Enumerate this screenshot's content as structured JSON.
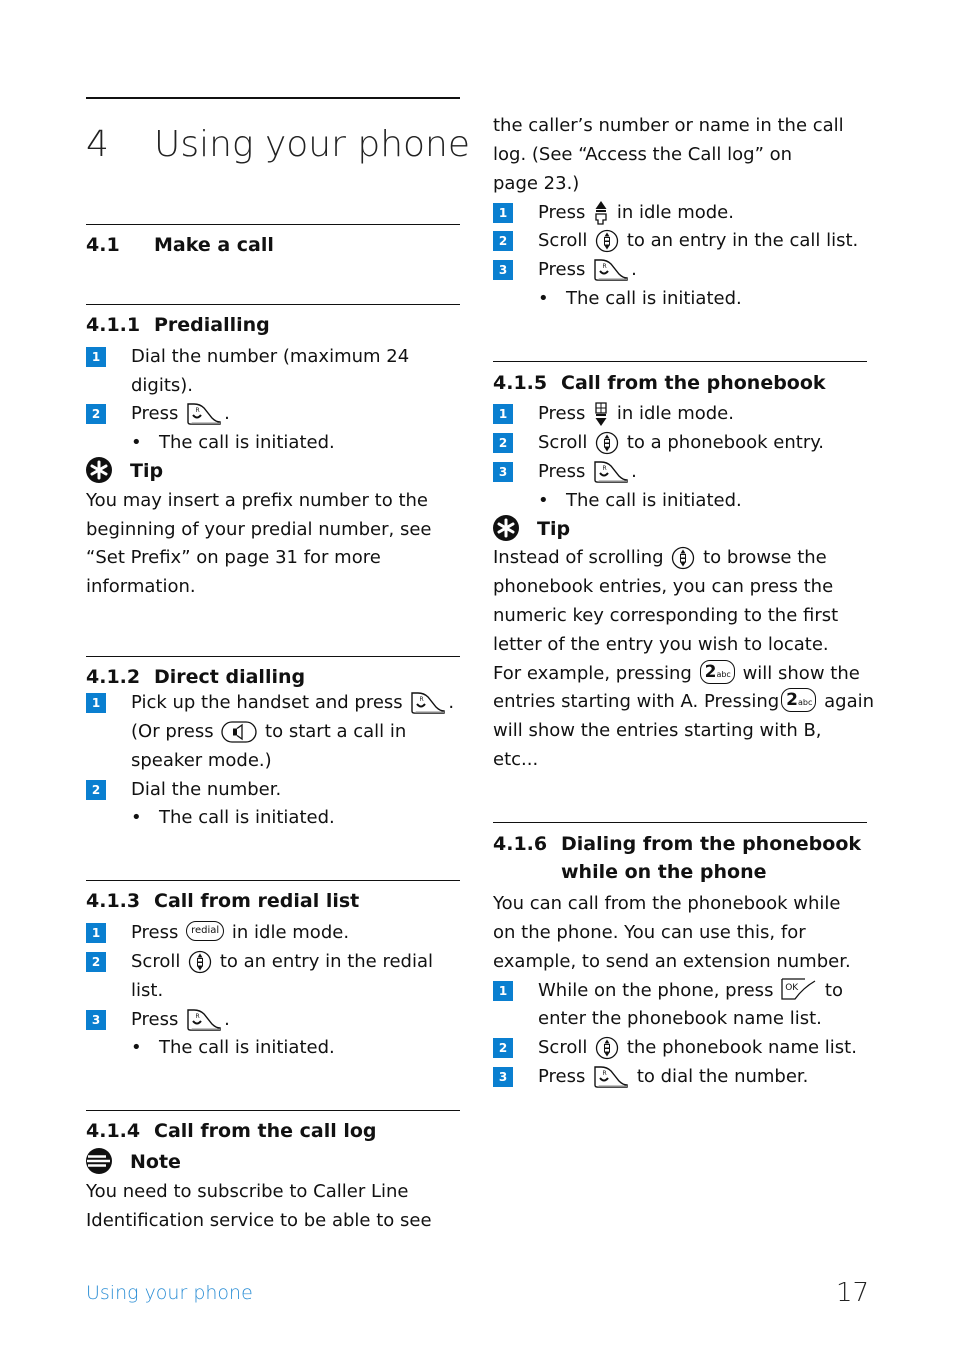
{
  "chapter": {
    "number": "4",
    "title": "Using your phone"
  },
  "section": {
    "number": "4.1",
    "title": "Make a call"
  },
  "colors": {
    "step_badge": "#0a7fd0",
    "footer_text": "#2a8dd4"
  },
  "subsections": {
    "s411": {
      "number": "4.1.1",
      "title": "Predialling",
      "steps": [
        {
          "n": "1",
          "lines": [
            "Dial the number (maximum 24",
            "digits)."
          ]
        },
        {
          "n": "2",
          "pre": "Press",
          "icon": "call-key-icon",
          "post": "."
        }
      ],
      "bullet": "The call is initiated.",
      "tip_label": "Tip",
      "tip_lines": [
        "You may insert a prefix number to the",
        "beginning of your predial number, see",
        "“Set Prefix” on page 31 for more",
        "information."
      ]
    },
    "s412": {
      "number": "4.1.2",
      "title": "Direct dialling",
      "steps": [
        {
          "n": "1",
          "line1_pre": "Pick up the handset and press",
          "line1_post": ".",
          "line2_pre": "(Or press",
          "line2_post": "to start a call in",
          "line3": "speaker mode.)"
        },
        {
          "n": "2",
          "text": "Dial the number."
        }
      ],
      "bullet": "The call is initiated."
    },
    "s413": {
      "number": "4.1.3",
      "title": "Call from redial list",
      "steps": [
        {
          "n": "1",
          "pre": "Press",
          "icon_label": "redial",
          "post": "in idle mode."
        },
        {
          "n": "2",
          "pre": "Scroll",
          "post": "to an entry in the redial",
          "line2": "list."
        },
        {
          "n": "3",
          "pre": "Press",
          "post": "."
        }
      ],
      "bullet": "The call is initiated."
    },
    "s414": {
      "number": "4.1.4",
      "title": "Call from the call log",
      "note_label": "Note",
      "note_lines": [
        "You need to subscribe to Caller Line",
        "Identification service to be able to see",
        "the caller’s number or name in the call",
        "log. (See “Access the Call log” on",
        "page 23.)"
      ],
      "steps": [
        {
          "n": "1",
          "pre": "Press",
          "post": "in idle mode."
        },
        {
          "n": "2",
          "pre": "Scroll",
          "post": "to an entry in the call list."
        },
        {
          "n": "3",
          "pre": "Press",
          "post": "."
        }
      ],
      "bullet": "The call is initiated."
    },
    "s415": {
      "number": "4.1.5",
      "title": "Call from the phonebook",
      "steps": [
        {
          "n": "1",
          "pre": "Press",
          "post": "in idle mode."
        },
        {
          "n": "2",
          "pre": "Scroll",
          "post": "to a phonebook entry."
        },
        {
          "n": "3",
          "pre": "Press",
          "post": "."
        }
      ],
      "bullet": "The call is initiated.",
      "tip_label": "Tip",
      "tip": {
        "l1_pre": "Instead of scrolling",
        "l1_post": "to browse the",
        "l2": "phonebook entries, you can press the",
        "l3": "numeric key corresponding to the first",
        "l4": "letter of the entry you wish to locate.",
        "l5_pre": "For example, pressing",
        "l5_post": "will show the",
        "l6_pre": "entries starting with A. Pressing",
        "l6_post": "again",
        "l7": "will show the entries starting with B,",
        "l8": "etc...",
        "key_digit": "2",
        "key_letters": "abc"
      }
    },
    "s416": {
      "number": "4.1.6",
      "title_line1": "Dialing from the phonebook",
      "title_line2": "while on the phone",
      "intro_lines": [
        "You can call from the phonebook while",
        "on the phone. You can use this, for",
        "example, to send an extension number."
      ],
      "steps": [
        {
          "n": "1",
          "pre": "While on the phone, press",
          "post": "to",
          "line2": "enter the phonebook name list.",
          "key_label": "OK"
        },
        {
          "n": "2",
          "pre": "Scroll",
          "post": "the phonebook name list."
        },
        {
          "n": "3",
          "pre": "Press",
          "post": "to dial the number."
        }
      ]
    }
  },
  "footer": {
    "section_name": "Using your phone",
    "page_number": "17"
  }
}
